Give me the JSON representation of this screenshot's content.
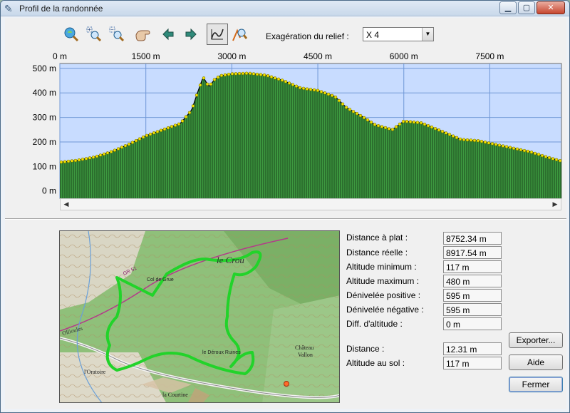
{
  "window": {
    "title": "Profil de la randonnée"
  },
  "toolbar": {
    "relief_label": "Exagération du relief :",
    "relief_value": "X 4",
    "tools": [
      "zoom-extent-icon",
      "zoom-in-icon",
      "zoom-out-icon",
      "pan-hand-icon",
      "arrow-left-icon",
      "arrow-right-icon",
      "profile-mode-icon",
      "measure-icon"
    ]
  },
  "chart_data": {
    "type": "area",
    "x_ticks": [
      "0 m",
      "1500 m",
      "3000 m",
      "4500 m",
      "6000 m",
      "7500 m"
    ],
    "y_ticks": [
      "500 m",
      "400 m",
      "300 m",
      "200 m",
      "100 m",
      "0 m"
    ],
    "xlim": [
      0,
      8750
    ],
    "ylim": [
      -30,
      520
    ],
    "x": [
      0,
      300,
      600,
      900,
      1200,
      1500,
      1800,
      2100,
      2300,
      2400,
      2500,
      2600,
      2700,
      2800,
      3000,
      3300,
      3600,
      3900,
      4200,
      4500,
      4800,
      5000,
      5300,
      5500,
      5800,
      6000,
      6300,
      6600,
      7000,
      7300,
      7600,
      7900,
      8200,
      8500,
      8750
    ],
    "y": [
      117,
      125,
      138,
      160,
      190,
      225,
      250,
      275,
      330,
      400,
      465,
      425,
      455,
      470,
      478,
      480,
      472,
      450,
      420,
      410,
      385,
      340,
      300,
      270,
      250,
      285,
      278,
      250,
      210,
      205,
      190,
      175,
      160,
      138,
      122
    ],
    "colors": {
      "fill": "#3d9a40",
      "line": "#000000",
      "marker": "#f2e000",
      "background": "#c8dcff",
      "grid": "#6f97d6"
    }
  },
  "stats": {
    "distance_plat": {
      "label": "Distance à plat :",
      "value": "8752.34 m"
    },
    "distance_reelle": {
      "label": "Distance réelle :",
      "value": "8917.54 m"
    },
    "altitude_min": {
      "label": "Altitude minimum :",
      "value": "117 m"
    },
    "altitude_max": {
      "label": "Altitude maximum :",
      "value": "480 m"
    },
    "deniv_pos": {
      "label": "Dénivelée positive :",
      "value": "595 m"
    },
    "deniv_neg": {
      "label": "Dénivelée négative :",
      "value": "595 m"
    },
    "diff_alt": {
      "label": "Diff. d'altitude :",
      "value": "0 m"
    },
    "distance": {
      "label": "Distance :",
      "value": "12.31 m"
    },
    "alt_sol": {
      "label": "Altitude au sol :",
      "value": "117 m"
    }
  },
  "buttons": {
    "export": "Exporter...",
    "help": "Aide",
    "close": "Fermer"
  },
  "map": {
    "labels": {
      "crou": "le Crou",
      "grue": "Col de Grue",
      "deroux": "le Déroux Ruines",
      "chateau": "Château",
      "vallon": "Vallon",
      "oratoire": "l'Oratoire",
      "courtine": "la Courtine",
      "gr": "GR 51",
      "ollioules": "Ollioules"
    }
  }
}
